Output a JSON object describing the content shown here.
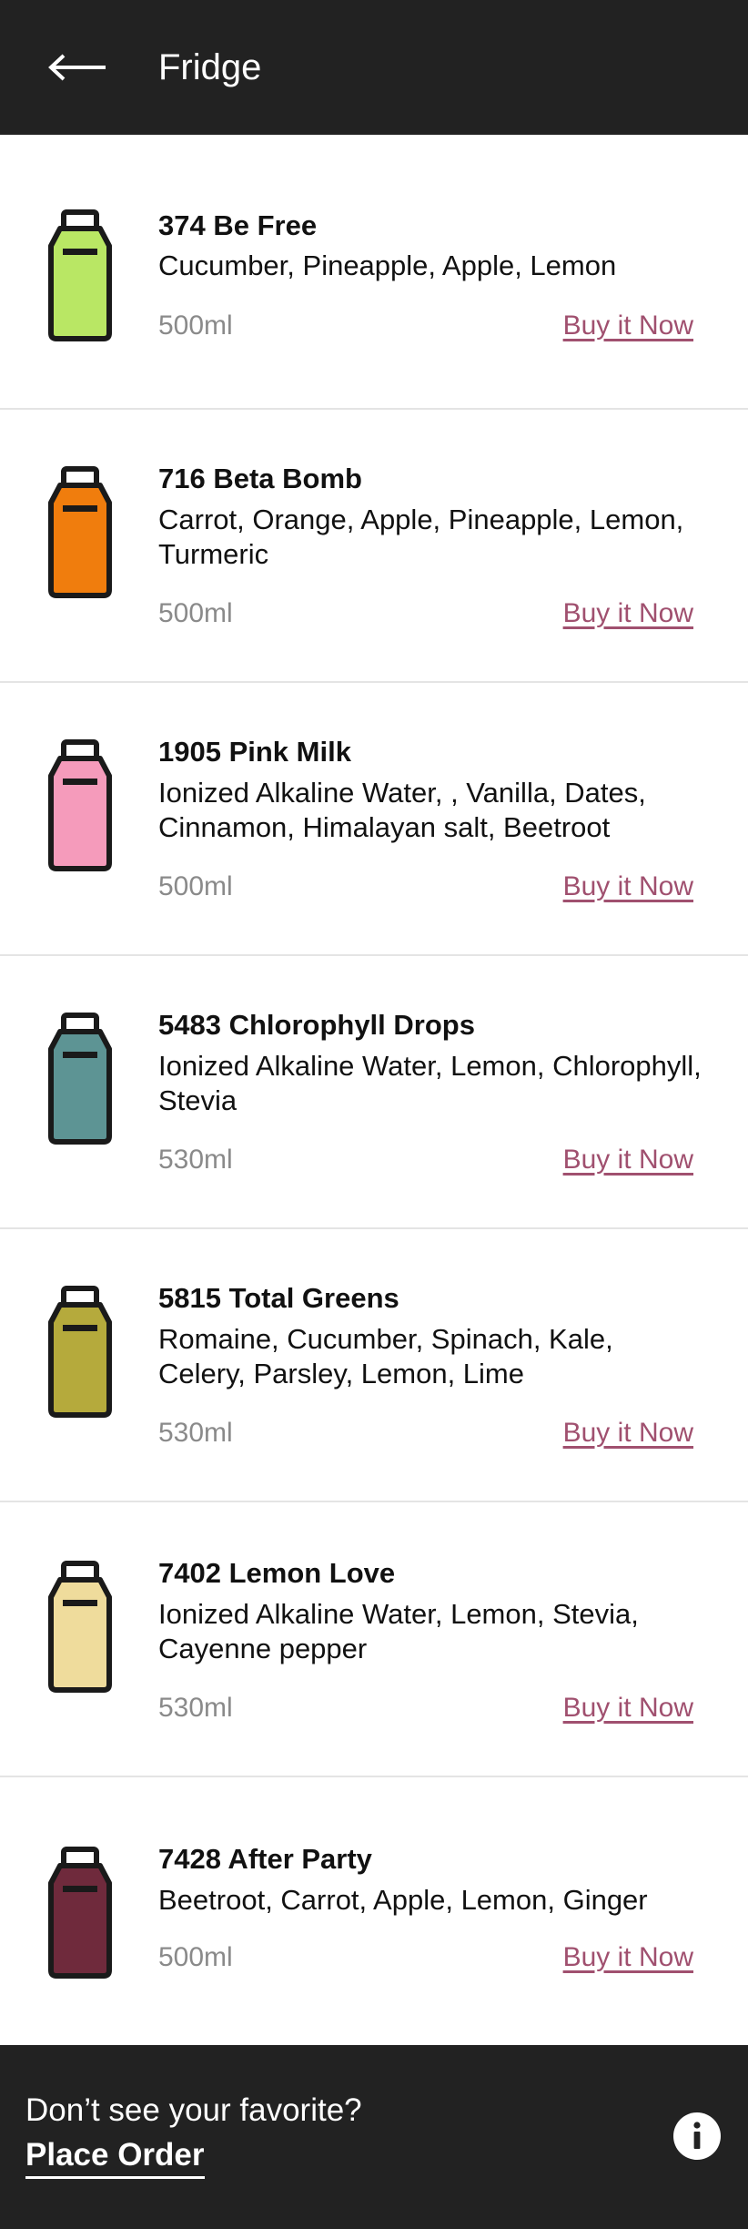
{
  "header": {
    "title": "Fridge",
    "back_icon": "arrow-left-icon"
  },
  "products": [
    {
      "name": "374 Be Free",
      "ingredients": "Cucumber, Pineapple, Apple, Lemon",
      "volume": "500ml",
      "buy_label": "Buy it Now",
      "bottle_color": "#b9e764"
    },
    {
      "name": "716 Beta Bomb",
      "ingredients": "Carrot, Orange, Apple, Pineapple, Lemon, Turmeric",
      "volume": "500ml",
      "buy_label": "Buy it Now",
      "bottle_color": "#f07d0d"
    },
    {
      "name": "1905 Pink Milk",
      "ingredients": "Ionized Alkaline Water, , Vanilla, Dates, Cinnamon, Himalayan salt, Beetroot",
      "volume": "500ml",
      "buy_label": "Buy it Now",
      "bottle_color": "#f59bbb"
    },
    {
      "name": "5483 Chlorophyll Drops",
      "ingredients": "Ionized Alkaline Water, Lemon, Chlorophyll, Stevia",
      "volume": "530ml",
      "buy_label": "Buy it Now",
      "bottle_color": "#5d9494"
    },
    {
      "name": "5815 Total Greens",
      "ingredients": "Romaine, Cucumber, Spinach, Kale, Celery, Parsley, Lemon, Lime",
      "volume": "530ml",
      "buy_label": "Buy it Now",
      "bottle_color": "#b5aa3c"
    },
    {
      "name": "7402 Lemon Love",
      "ingredients": "Ionized Alkaline Water, Lemon, Stevia, Cayenne pepper",
      "volume": "530ml",
      "buy_label": "Buy it Now",
      "bottle_color": "#efdc9c"
    },
    {
      "name": "7428 After Party",
      "ingredients": "Beetroot, Carrot, Apple, Lemon, Ginger",
      "volume": "500ml",
      "buy_label": "Buy it Now",
      "bottle_color": "#6f2a3c"
    }
  ],
  "footer": {
    "question": "Don’t see your favorite?",
    "cta": "Place Order",
    "info_icon": "info-icon"
  },
  "colors": {
    "bar": "#222222",
    "link": "#a0506f",
    "muted": "#8a8a8a"
  }
}
